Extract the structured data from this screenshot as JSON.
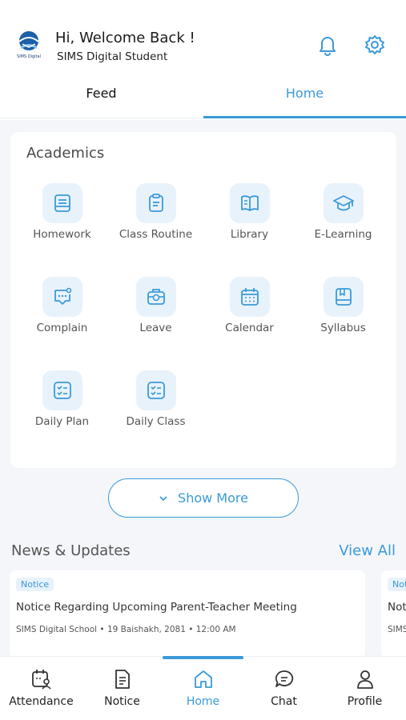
{
  "header": {
    "logo_text": "SIMS Digital",
    "greeting": "Hi, Welcome Back !",
    "subtitle": "SIMS Digital Student",
    "icons": [
      "bell-icon",
      "gear-icon"
    ]
  },
  "tabs": [
    {
      "label": "Feed",
      "active": false
    },
    {
      "label": "Home",
      "active": true
    }
  ],
  "academics": {
    "title": "Academics",
    "items": [
      {
        "label": "Homework",
        "icon": "homework-icon"
      },
      {
        "label": "Class Routine",
        "icon": "clipboard-icon"
      },
      {
        "label": "Library",
        "icon": "book-icon"
      },
      {
        "label": "E-Learning",
        "icon": "graduation-cap-icon"
      },
      {
        "label": "Complain",
        "icon": "chat-alert-icon"
      },
      {
        "label": "Leave",
        "icon": "briefcase-icon"
      },
      {
        "label": "Calendar",
        "icon": "calendar-icon"
      },
      {
        "label": "Syllabus",
        "icon": "syllabus-icon"
      },
      {
        "label": "Daily Plan",
        "icon": "checklist-icon"
      },
      {
        "label": "Daily Class",
        "icon": "checklist-icon"
      }
    ]
  },
  "show_more": {
    "label": "Show More"
  },
  "news": {
    "title": "News & Updates",
    "view_all": "View All",
    "cards": [
      {
        "badge": "Notice",
        "headline": "Notice Regarding Upcoming Parent-Teacher Meeting",
        "meta": "SIMS Digital School • 19 Baishakh, 2081 • 12:00 AM"
      },
      {
        "badge": "Notice",
        "headline": "Notice",
        "meta": "SIMS"
      }
    ]
  },
  "bottom_nav": [
    {
      "label": "Attendance",
      "icon": "attendance-icon",
      "active": false
    },
    {
      "label": "Notice",
      "icon": "document-icon",
      "active": false
    },
    {
      "label": "Home",
      "icon": "home-icon",
      "active": true
    },
    {
      "label": "Chat",
      "icon": "chat-icon",
      "active": false
    },
    {
      "label": "Profile",
      "icon": "user-icon",
      "active": false
    }
  ],
  "colors": {
    "accent": "#3a9ad9",
    "tile_bg": "#e8f2fb",
    "background": "#f4f6f9"
  }
}
